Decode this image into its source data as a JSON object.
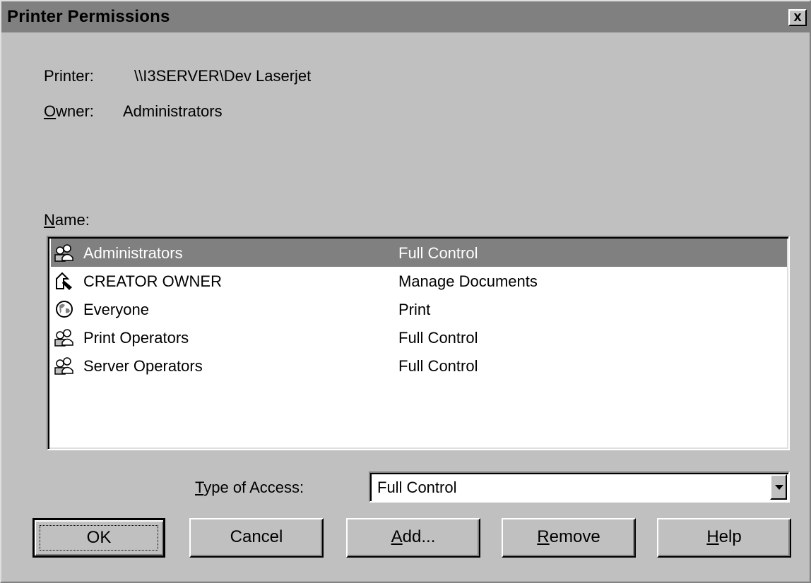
{
  "window": {
    "title": "Printer Permissions",
    "close_label": "x"
  },
  "printer": {
    "label": "Printer:",
    "value": "\\\\I3SERVER\\Dev Laserjet"
  },
  "owner": {
    "label_underlined": "O",
    "label_rest": "wner:",
    "value": "Administrators"
  },
  "names": {
    "label_underlined": "N",
    "label_rest": "ame:",
    "rows": [
      {
        "name": "Administrators",
        "access": "Full Control",
        "icon": "group-icon",
        "selected": true
      },
      {
        "name": "CREATOR OWNER",
        "access": "Manage Documents",
        "icon": "creator-owner-icon",
        "selected": false
      },
      {
        "name": "Everyone",
        "access": "Print",
        "icon": "globe-icon",
        "selected": false
      },
      {
        "name": "Print Operators",
        "access": "Full Control",
        "icon": "group-icon",
        "selected": false
      },
      {
        "name": "Server Operators",
        "access": "Full Control",
        "icon": "group-icon",
        "selected": false
      }
    ]
  },
  "type_of_access": {
    "label_underlined": "T",
    "label_rest": "ype of Access:",
    "value": "Full Control"
  },
  "buttons": {
    "ok": "OK",
    "cancel": "Cancel",
    "add_u": "A",
    "add_rest": "dd...",
    "remove_u": "R",
    "remove_rest": "emove",
    "help_u": "H",
    "help_rest": "elp"
  },
  "colors": {
    "face": "#c0c0c0",
    "titlebar": "#808080",
    "selection": "#808080"
  }
}
